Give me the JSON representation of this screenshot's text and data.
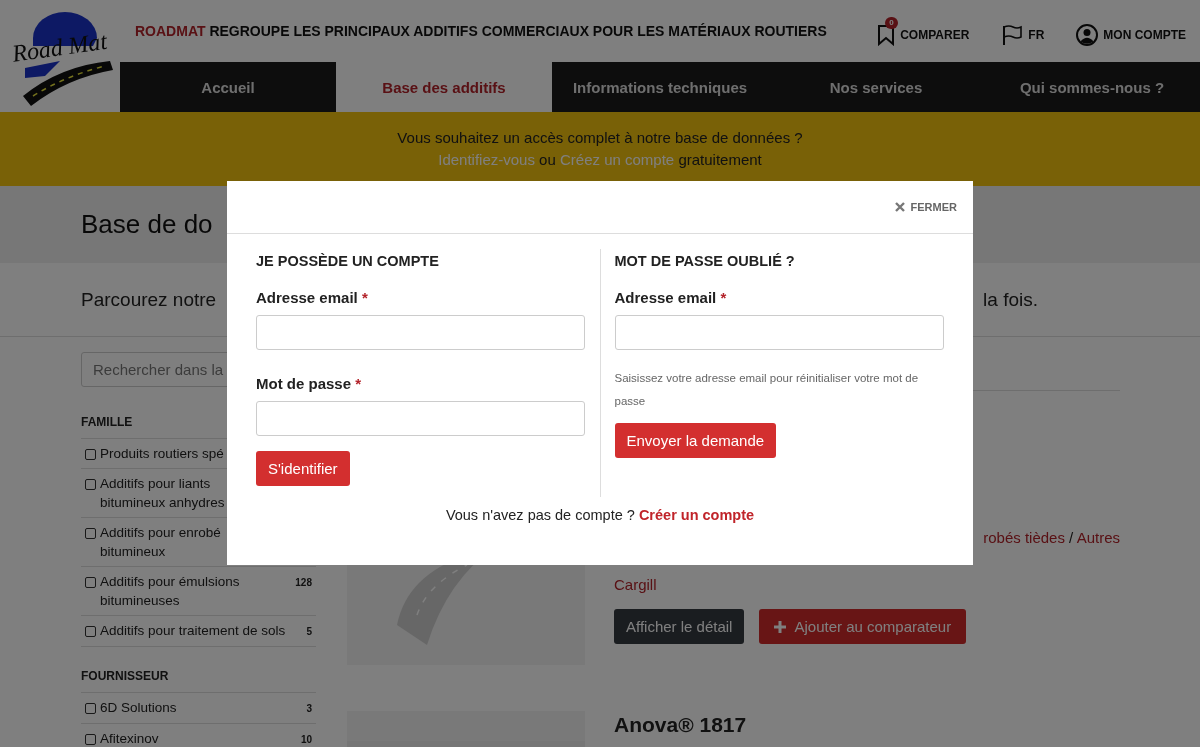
{
  "header": {
    "logo_text": "Road Mat",
    "brand": "ROADMAT",
    "tagline": "REGROUPE LES PRINCIPAUX ADDITIFS COMMERCIAUX POUR LES MATÉRIAUX ROUTIERS",
    "actions": [
      {
        "kind": "compare",
        "label": "COMPARER",
        "badge": "0"
      },
      {
        "kind": "language",
        "label": "FR"
      },
      {
        "kind": "account",
        "label": "MON COMPTE"
      }
    ]
  },
  "nav": [
    {
      "label": "Accueil",
      "selected": false
    },
    {
      "label": "Base des additifs",
      "selected": true
    },
    {
      "label": "Informations techniques",
      "selected": false
    },
    {
      "label": "Nos services",
      "selected": false
    },
    {
      "label": "Qui sommes-nous ?",
      "selected": false
    }
  ],
  "banner": {
    "line_1": "Vous souhaitez un accès complet à notre base de données ?",
    "line_2": [
      {
        "text": "Identifiez-vous",
        "link": true
      },
      {
        "text": "ou",
        "link": false
      },
      {
        "text": "Créez un compte",
        "link": true
      },
      {
        "text": "gratuitement",
        "link": false
      }
    ]
  },
  "page": {
    "title": "Base de do",
    "intro_start": "Parcourez notre",
    "intro_end": "la fois."
  },
  "sidebar": {
    "search": {
      "placeholder": "Rechercher dans la"
    },
    "groups": [
      {
        "title": "FAMILLE",
        "items": [
          {
            "lines": [
              "Produits routiers spé"
            ],
            "checked": false
          },
          {
            "lines": [
              "Additifs pour liants",
              "bitumineux anhydres"
            ],
            "checked": false
          },
          {
            "lines": [
              "Additifs pour enrobé",
              "bitumineux"
            ],
            "checked": false
          },
          {
            "lines": [
              "Additifs pour émulsions",
              "bitumineuses"
            ],
            "count": "128",
            "checked": false
          },
          {
            "lines": [
              "Additifs pour traitement de sols"
            ],
            "count": "5",
            "checked": false
          }
        ]
      },
      {
        "title": "FOURNISSEUR",
        "items": [
          {
            "lines": [
              "6D Solutions"
            ],
            "count": "3",
            "checked": false
          },
          {
            "lines": [
              "Afitexinov"
            ],
            "count": "10",
            "checked": false
          }
        ]
      }
    ]
  },
  "results": [
    {
      "categories": [
        "robés tièdes",
        "Autres"
      ],
      "separator": "/",
      "supplier": "Cargill",
      "buttons": [
        {
          "kind": "detail",
          "label": "Afficher le détail"
        },
        {
          "kind": "compare",
          "label": "Ajouter au comparateur"
        }
      ]
    },
    {
      "title": "Anova® 1817"
    }
  ],
  "modal": {
    "close": "FERMER",
    "login": {
      "heading": "JE POSSÈDE UN COMPTE",
      "fields": [
        {
          "label": "Adresse email",
          "required_mark": "*"
        },
        {
          "label": "Mot de passe",
          "required_mark": "*"
        }
      ],
      "button": "S'identifier"
    },
    "forgot": {
      "heading": "MOT DE PASSE OUBLIÉ ?",
      "fields": [
        {
          "label": "Adresse email",
          "required_mark": "*"
        }
      ],
      "help": "Saisissez votre adresse email pour réinitialiser votre mot de passe",
      "button": "Envoyer la demande"
    },
    "footer": {
      "text": "Vous n'avez pas de compte ?",
      "link": "Créer un compte"
    }
  }
}
